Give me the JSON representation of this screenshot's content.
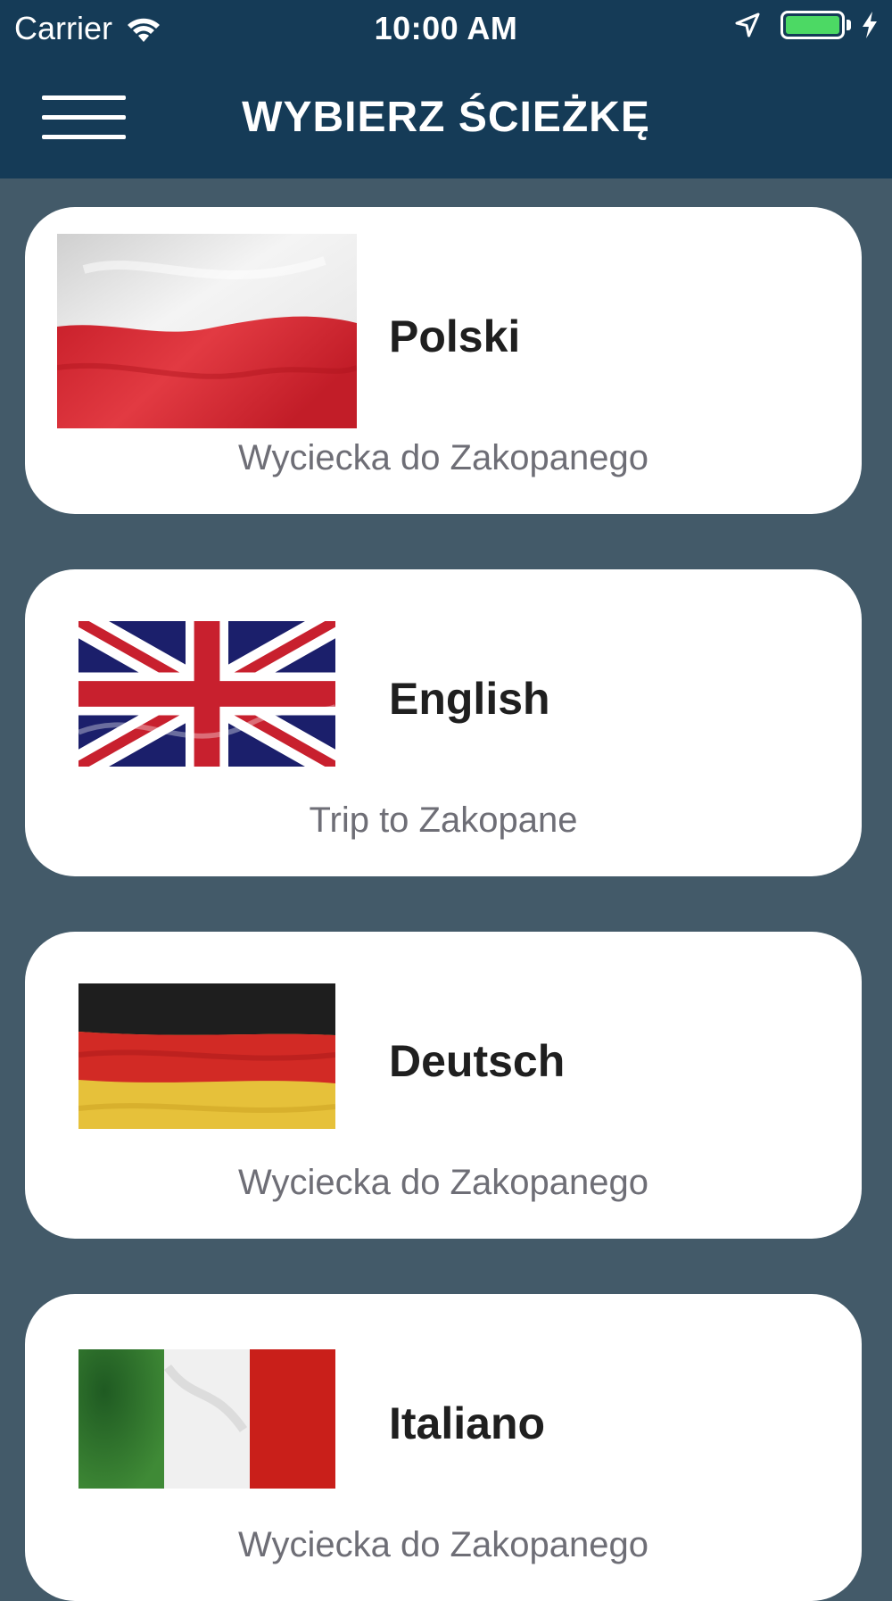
{
  "status_bar": {
    "carrier": "Carrier",
    "time": "10:00 AM",
    "battery_color": "#4cd964"
  },
  "nav": {
    "title": "WYBIERZ ŚCIEŻKĘ",
    "menu_icon": "hamburger-menu-icon",
    "background": "#153b57"
  },
  "page_background": "#435a69",
  "languages": [
    {
      "label": "Polski",
      "subtitle": "Wyciecka do Zakopanego",
      "flag": "poland-flag"
    },
    {
      "label": "English",
      "subtitle": "Trip to Zakopane",
      "flag": "united-kingdom-flag"
    },
    {
      "label": "Deutsch",
      "subtitle": "Wyciecka do Zakopanego",
      "flag": "germany-flag"
    },
    {
      "label": "Italiano",
      "subtitle": "Wyciecka do Zakopanego",
      "flag": "italy-flag"
    }
  ]
}
